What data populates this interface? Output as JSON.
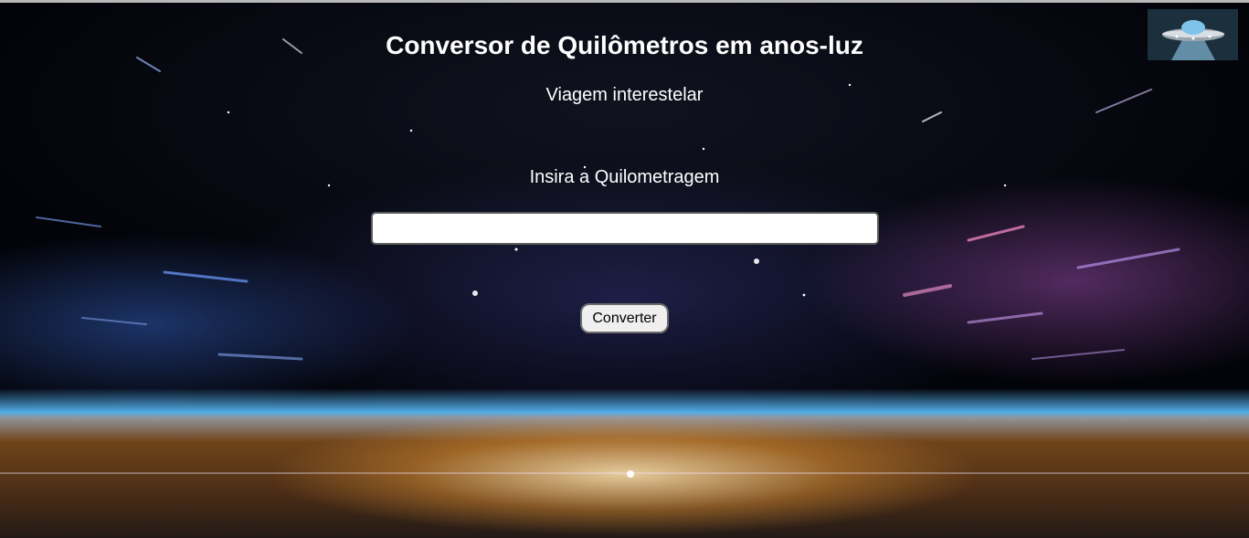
{
  "page": {
    "title": "Conversor de Quilômetros em anos-luz",
    "subtitle": "Viagem interestelar"
  },
  "form": {
    "label": "Insira a Quilometragem",
    "input_value": "",
    "button_label": "Converter"
  },
  "images": {
    "background": "galaxy-warp-background",
    "corner_logo": "ufo-icon"
  }
}
